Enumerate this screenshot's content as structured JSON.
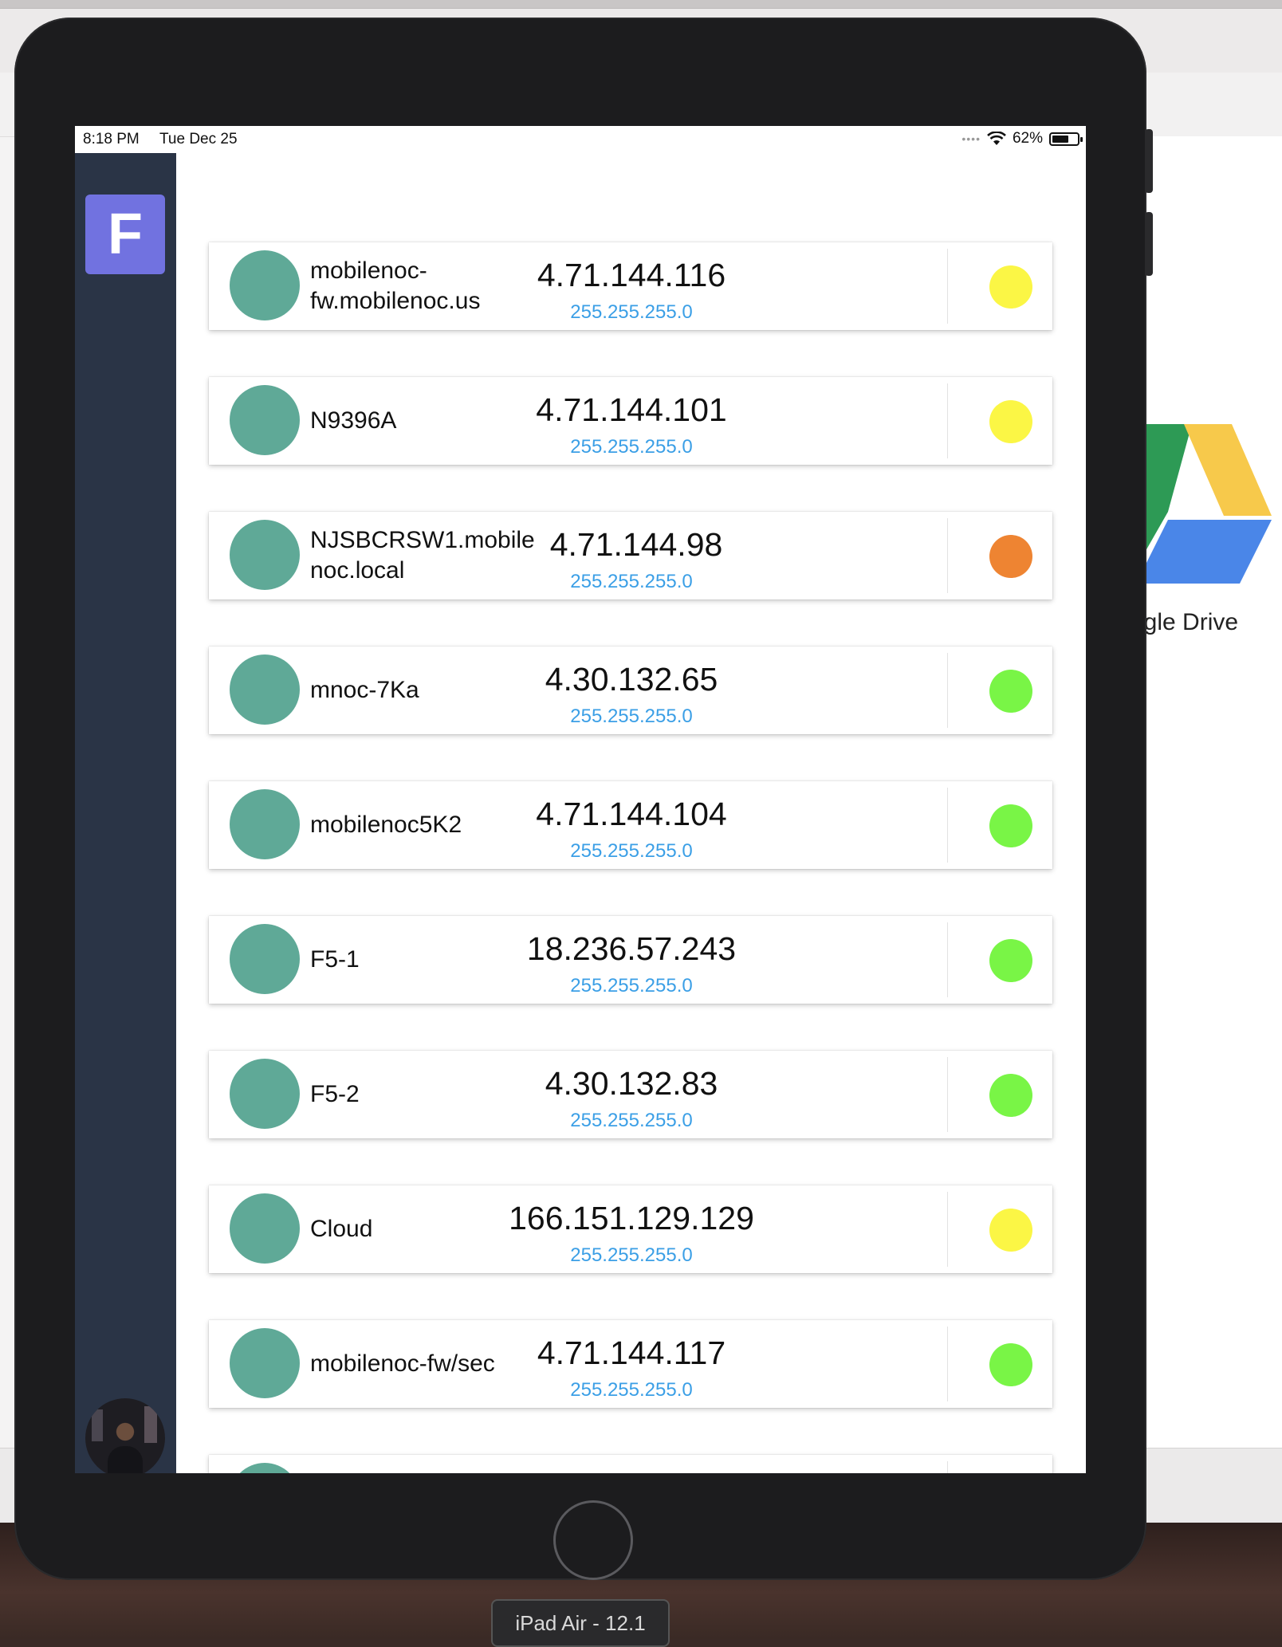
{
  "status_bar": {
    "time": "8:18 PM",
    "date": "Tue Dec 25",
    "battery": "62%"
  },
  "sidebar": {
    "logo_letter": "F"
  },
  "desktop": {
    "google_drive_label": "ogle Drive"
  },
  "simulator_label": "iPad Air - 12.1",
  "status_colors": {
    "yellow": "#fbf645",
    "orange": "#ee8432",
    "green": "#79f546"
  },
  "devices": [
    {
      "name": "mobilenoc-\nfw.mobilenoc.us",
      "ip": "4.71.144.116",
      "mask": "255.255.255.0",
      "status": "yellow"
    },
    {
      "name": "N9396A",
      "ip": "4.71.144.101",
      "mask": "255.255.255.0",
      "status": "yellow"
    },
    {
      "name": "NJSBCRSW1.mobile\nnoc.local",
      "ip": "4.71.144.98",
      "mask": "255.255.255.0",
      "status": "orange"
    },
    {
      "name": "mnoc-7Ka",
      "ip": "4.30.132.65",
      "mask": "255.255.255.0",
      "status": "green"
    },
    {
      "name": "mobilenoc5K2",
      "ip": "4.71.144.104",
      "mask": "255.255.255.0",
      "status": "green"
    },
    {
      "name": "F5-1",
      "ip": "18.236.57.243",
      "mask": "255.255.255.0",
      "status": "green"
    },
    {
      "name": "F5-2",
      "ip": "4.30.132.83",
      "mask": "255.255.255.0",
      "status": "green"
    },
    {
      "name": "Cloud",
      "ip": "166.151.129.129",
      "mask": "255.255.255.0",
      "status": "yellow"
    },
    {
      "name": "mobilenoc-fw/sec",
      "ip": "4.71.144.117",
      "mask": "255.255.255.0",
      "status": "green"
    },
    {
      "name": "",
      "ip": "",
      "mask": "",
      "status": "green"
    }
  ]
}
